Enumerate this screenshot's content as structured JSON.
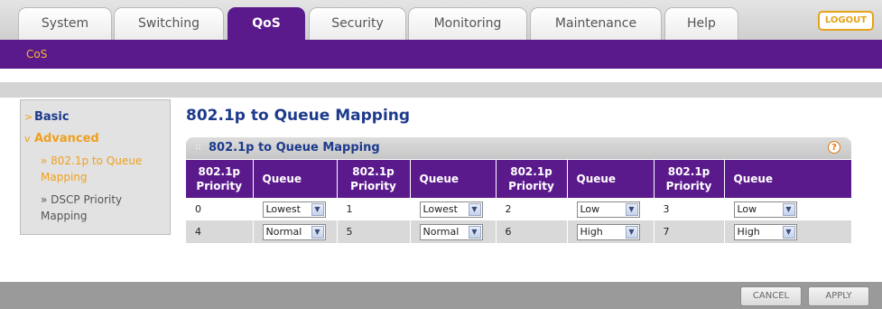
{
  "tabs": [
    {
      "label": "System",
      "active": false
    },
    {
      "label": "Switching",
      "active": false
    },
    {
      "label": "QoS",
      "active": true
    },
    {
      "label": "Security",
      "active": false
    },
    {
      "label": "Monitoring",
      "active": false
    },
    {
      "label": "Maintenance",
      "active": false
    },
    {
      "label": "Help",
      "active": false
    }
  ],
  "logout_label": "LOGOUT",
  "subnav": {
    "active": "CoS"
  },
  "sidebar": {
    "basic": "Basic",
    "advanced": "Advanced",
    "items": [
      {
        "line1": "» 802.1p to Queue",
        "line2": "Mapping",
        "selected": true
      },
      {
        "line1": "» DSCP Priority",
        "line2": "Mapping",
        "selected": false
      }
    ]
  },
  "page_title": "802.1p to Queue Mapping",
  "panel": {
    "title": "802.1p to Queue Mapping",
    "help_icon": "?",
    "columns": [
      "802.1p Priority",
      "Queue",
      "802.1p Priority",
      "Queue",
      "802.1p Priority",
      "Queue",
      "802.1p Priority",
      "Queue"
    ],
    "rows": [
      [
        {
          "priority": "0",
          "queue": "Lowest"
        },
        {
          "priority": "1",
          "queue": "Lowest"
        },
        {
          "priority": "2",
          "queue": "Low"
        },
        {
          "priority": "3",
          "queue": "Low"
        }
      ],
      [
        {
          "priority": "4",
          "queue": "Normal"
        },
        {
          "priority": "5",
          "queue": "Normal"
        },
        {
          "priority": "6",
          "queue": "High"
        },
        {
          "priority": "7",
          "queue": "High"
        }
      ]
    ]
  },
  "footer": {
    "cancel": "CANCEL",
    "apply": "APPLY"
  },
  "colors": {
    "brand_purple": "#5a1a8c",
    "accent_orange": "#f0a01c",
    "title_blue": "#1d3a8c"
  }
}
